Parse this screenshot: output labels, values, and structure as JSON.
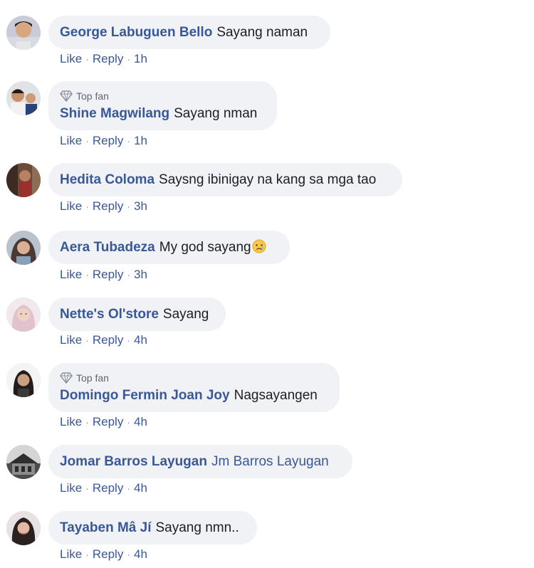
{
  "actions": {
    "like": "Like",
    "reply": "Reply",
    "separator": "·"
  },
  "badge_label": "Top fan",
  "colors": {
    "link": "#385898",
    "bubble": "#f0f2f5",
    "text": "#1c1e21",
    "muted": "#606770"
  },
  "comments": [
    {
      "author": "George Labuguen Bello",
      "text": "Sayang naman",
      "time": "1h"
    },
    {
      "author": "Shine Magwilang",
      "text": "Sayang nman",
      "time": "1h",
      "badge": "Top fan"
    },
    {
      "author": "Hedita Coloma",
      "text": "Saysng ibinigay na kang sa mga tao",
      "time": "3h"
    },
    {
      "author": "Aera Tubadeza",
      "text": "My god sayang",
      "emoji": "crying-face-icon",
      "time": "3h"
    },
    {
      "author": "Nette's Ol'store",
      "text": "Sayang",
      "time": "4h"
    },
    {
      "author": "Domingo Fermin Joan Joy",
      "text": "Nagsayangen",
      "time": "4h",
      "badge": "Top fan"
    },
    {
      "author": "Jomar Barros Layugan",
      "mention": "Jm Barros Layugan",
      "time": "4h"
    },
    {
      "author": "Tayaben Mâ Jí",
      "text": "Sayang nmn..",
      "time": "4h"
    }
  ]
}
